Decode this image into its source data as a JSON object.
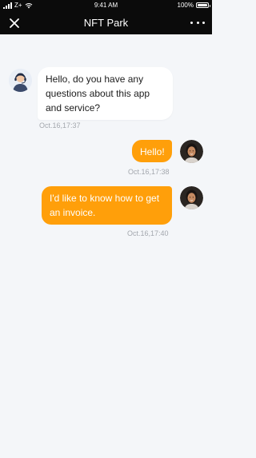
{
  "status_bar": {
    "carrier": "Z+",
    "time": "9:41 AM",
    "battery": "100%",
    "battery_level": 1.0
  },
  "header": {
    "title": "NFT Park",
    "close_icon": "close-icon",
    "more_icon": "more-horizontal-icon"
  },
  "messages": [
    {
      "sender": "support",
      "text": "Hello, do you have any questions about this app and service?",
      "timestamp": "Oct.16,17:37"
    },
    {
      "sender": "user",
      "text": "Hello!",
      "timestamp": "Oct.16,17:38"
    },
    {
      "sender": "user",
      "text": "I'd like to know how to get an invoice.",
      "timestamp": "Oct.16,17:40"
    }
  ],
  "colors": {
    "header_bg": "#0b0b0b",
    "page_bg": "#f4f6f9",
    "outgoing_bubble": "#ff9f0a",
    "incoming_bubble": "#ffffff",
    "timestamp": "#a3a7ad"
  }
}
